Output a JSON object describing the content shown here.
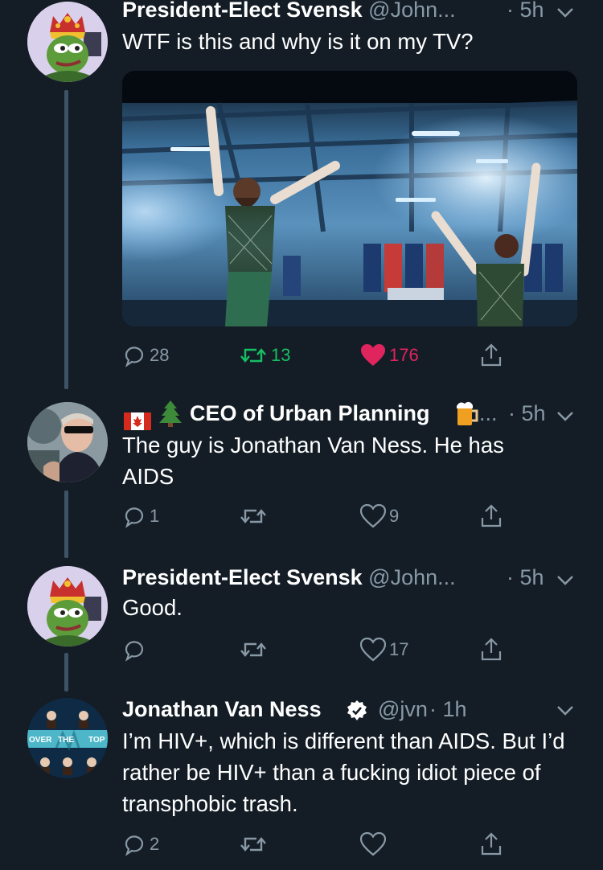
{
  "tweets": [
    {
      "name": "President-Elect Svensk",
      "handle": "@John...",
      "time": "· 5h",
      "text": "WTF is this and why is it on my TV?",
      "replies": "28",
      "retweets": "13",
      "likes": "176",
      "retweeted": true,
      "liked": true
    },
    {
      "name": "CEO of Urban Planning",
      "prefix_icons": [
        "canada-flag-icon",
        "christmas-tree-icon"
      ],
      "suffix_icon": "beer-mug-icon",
      "handle": "...",
      "time": "· 5h",
      "text": "The guy is Jonathan Van Ness. He has AIDS",
      "replies": "1",
      "retweets": "",
      "likes": "9"
    },
    {
      "name": "President-Elect Svensk",
      "handle": "@John...",
      "time": "· 5h",
      "text": "Good.",
      "replies": "",
      "retweets": "",
      "likes": "17"
    },
    {
      "name": "Jonathan Van Ness",
      "verified": true,
      "handle": "@jvn",
      "time": "· 1h",
      "text": "I’m HIV+, which is different than AIDS. But I’d rather be HIV+ than a fucking idiot piece of transphobic trash.",
      "replies": "2",
      "retweets": "",
      "likes": "",
      "avatar_text": [
        "OVER",
        "THE",
        "TOP"
      ]
    }
  ],
  "colors": {
    "background": "#141d26",
    "secondary_text": "#8899a6",
    "retweet_green": "#17bf63",
    "like_red": "#e0245e",
    "thread_line": "#3d5466"
  }
}
